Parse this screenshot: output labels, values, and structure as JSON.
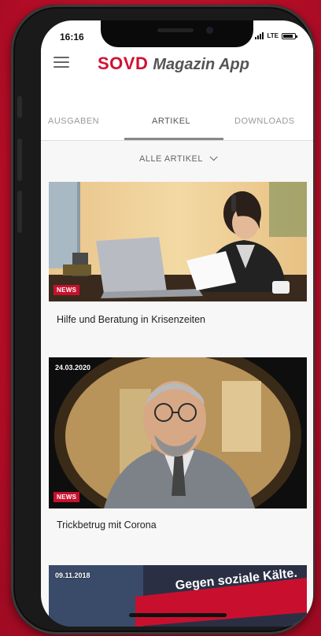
{
  "status_bar": {
    "time": "16:16",
    "network": "LTE",
    "battery_level": 0.85
  },
  "app": {
    "brand_mark": "SOVD",
    "brand_name": "Magazin App"
  },
  "tabs": [
    {
      "label": "AUSGABEN",
      "active": false
    },
    {
      "label": "ARTIKEL",
      "active": true
    },
    {
      "label": "DOWNLOADS",
      "active": false
    }
  ],
  "filter": {
    "label": "ALLE ARTIKEL"
  },
  "articles": [
    {
      "badge": "NEWS",
      "date": "",
      "title": "Hilfe und Beratung in Krisenzeiten"
    },
    {
      "badge": "NEWS",
      "date": "24.03.2020",
      "title": "Trickbetrug mit Corona"
    },
    {
      "badge": "",
      "date": "09.11.2018",
      "title": "",
      "banner_text": "Gegen soziale Kälte."
    }
  ],
  "colors": {
    "accent": "#c8102e",
    "brand_red": "#d21033"
  }
}
